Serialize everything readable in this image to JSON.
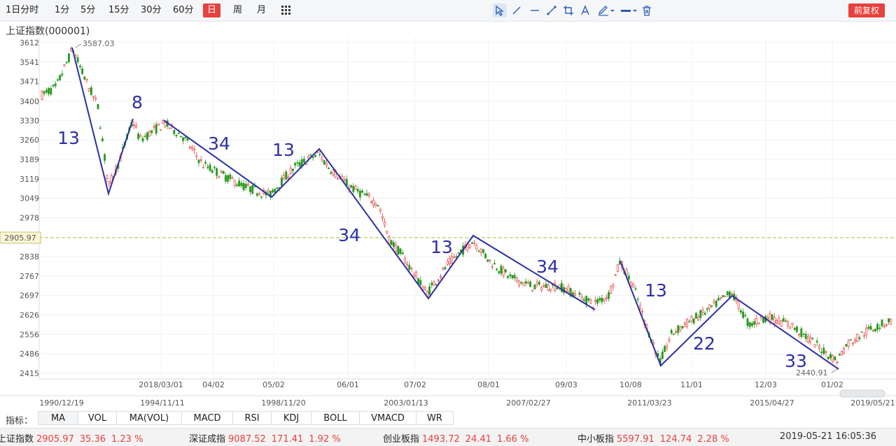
{
  "toolbar": {
    "timeframes": [
      {
        "label": "1日分时",
        "active": false
      },
      {
        "label": "1分",
        "active": false
      },
      {
        "label": "5分",
        "active": false
      },
      {
        "label": "15分",
        "active": false
      },
      {
        "label": "30分",
        "active": false
      },
      {
        "label": "60分",
        "active": false
      },
      {
        "label": "日",
        "active": true
      },
      {
        "label": "周",
        "active": false
      },
      {
        "label": "月",
        "active": false
      }
    ],
    "grid_icon": "grid-icon",
    "draw_tools": [
      "cursor-icon",
      "line-icon",
      "horizontal-line-icon",
      "segment-icon",
      "crop-icon",
      "text-icon",
      "pen-icon",
      "line-style-icon",
      "trash-icon"
    ],
    "adjust_button": "前复权"
  },
  "chart": {
    "title": "上证指数(000001)",
    "price_ticks": [
      "3612",
      "3541",
      "3471",
      "3400",
      "3330",
      "3260",
      "3189",
      "3119",
      "3049",
      "2978",
      "2905.97",
      "2838",
      "2767",
      "2697",
      "2626",
      "2556",
      "2486",
      "2415"
    ],
    "inner_date_ticks": [
      "2018/03/01",
      "04/02",
      "05/02",
      "06/01",
      "07/02",
      "08/01",
      "09/03",
      "10/08",
      "11/01",
      "12/03",
      "01/02"
    ],
    "outer_date_ticks": [
      "1990/12/19",
      "1994/11/11",
      "1998/11/20",
      "2003/01/13",
      "2007/02/27",
      "2011/03/23",
      "2015/04/27",
      "2019/05/21"
    ],
    "high_label": "3587.03",
    "low_label": "2440.91",
    "current_price": "2905.97",
    "wave_labels": [
      "13",
      "8",
      "34",
      "13",
      "34",
      "13",
      "34",
      "13",
      "22",
      "33"
    ],
    "colors": {
      "up": "#e8403d",
      "down": "#2a9a1f",
      "wave": "#2b2fa8",
      "price_line": "#9bc43a",
      "grid": "#eef0f3"
    }
  },
  "indicators": {
    "label": "指标：",
    "items": [
      "MA",
      "VOL",
      "MA(VOL)",
      "MACD",
      "RSI",
      "KDJ",
      "BOLL",
      "VMACD",
      "WR"
    ]
  },
  "status": {
    "items": [
      {
        "name": "上证指数",
        "price": "2905.97",
        "change": "35.36",
        "pct": "1.23 %"
      },
      {
        "name": "深证成指",
        "price": "9087.52",
        "change": "171.41",
        "pct": "1.92 %"
      },
      {
        "name": "创业板指",
        "price": "1493.72",
        "change": "24.41",
        "pct": "1.66 %"
      },
      {
        "name": "中小板指",
        "price": "5597.91",
        "change": "124.74",
        "pct": "2.28 %"
      }
    ],
    "datetime": "2019-05-21 16:05:36"
  }
}
